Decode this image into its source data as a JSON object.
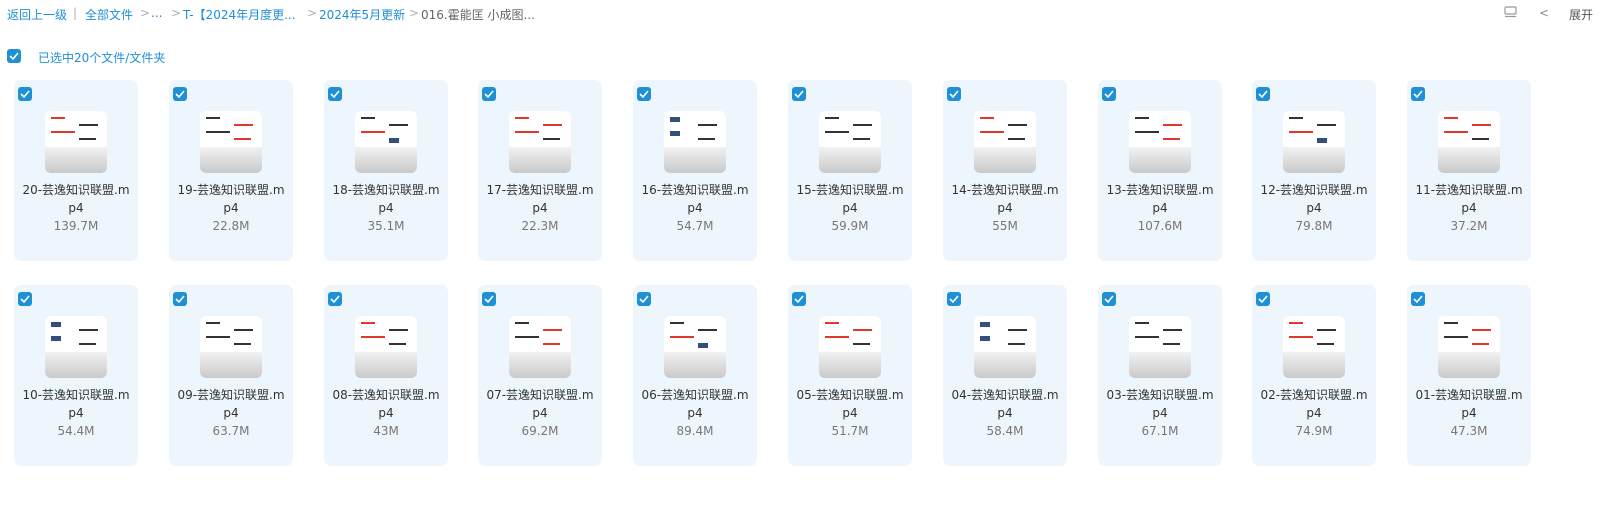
{
  "breadcrumb": {
    "back": "返回上一级",
    "sep": "|",
    "all_files": "全部文件",
    "ellipsis": "...",
    "folder1": "T-【2024年月度更...",
    "folder2": "2024年5月更新",
    "current": "016.霍能匡 小成图...",
    "chevron": ">"
  },
  "toolbar": {
    "view_icon": "list-view-icon",
    "collapse_chevron": "<",
    "expand_label": "展开"
  },
  "selection": {
    "label": "已选中20个文件/文件夹",
    "checked": true
  },
  "colors": {
    "accent": "#1f8fd6",
    "card_bg": "#eef6fd"
  },
  "files": [
    {
      "name": "20-芸逸知识联盟.mp4",
      "size": "139.7M",
      "checked": true
    },
    {
      "name": "19-芸逸知识联盟.mp4",
      "size": "22.8M",
      "checked": true
    },
    {
      "name": "18-芸逸知识联盟.mp4",
      "size": "35.1M",
      "checked": true
    },
    {
      "name": "17-芸逸知识联盟.mp4",
      "size": "22.3M",
      "checked": true
    },
    {
      "name": "16-芸逸知识联盟.mp4",
      "size": "54.7M",
      "checked": true
    },
    {
      "name": "15-芸逸知识联盟.mp4",
      "size": "59.9M",
      "checked": true
    },
    {
      "name": "14-芸逸知识联盟.mp4",
      "size": "55M",
      "checked": true
    },
    {
      "name": "13-芸逸知识联盟.mp4",
      "size": "107.6M",
      "checked": true
    },
    {
      "name": "12-芸逸知识联盟.mp4",
      "size": "79.8M",
      "checked": true
    },
    {
      "name": "11-芸逸知识联盟.mp4",
      "size": "37.2M",
      "checked": true
    },
    {
      "name": "10-芸逸知识联盟.mp4",
      "size": "54.4M",
      "checked": true
    },
    {
      "name": "09-芸逸知识联盟.mp4",
      "size": "63.7M",
      "checked": true
    },
    {
      "name": "08-芸逸知识联盟.mp4",
      "size": "43M",
      "checked": true
    },
    {
      "name": "07-芸逸知识联盟.mp4",
      "size": "69.2M",
      "checked": true
    },
    {
      "name": "06-芸逸知识联盟.mp4",
      "size": "89.4M",
      "checked": true
    },
    {
      "name": "05-芸逸知识联盟.mp4",
      "size": "51.7M",
      "checked": true
    },
    {
      "name": "04-芸逸知识联盟.mp4",
      "size": "58.4M",
      "checked": true
    },
    {
      "name": "03-芸逸知识联盟.mp4",
      "size": "67.1M",
      "checked": true
    },
    {
      "name": "02-芸逸知识联盟.mp4",
      "size": "74.9M",
      "checked": true
    },
    {
      "name": "01-芸逸知识联盟.mp4",
      "size": "47.3M",
      "checked": true
    }
  ]
}
